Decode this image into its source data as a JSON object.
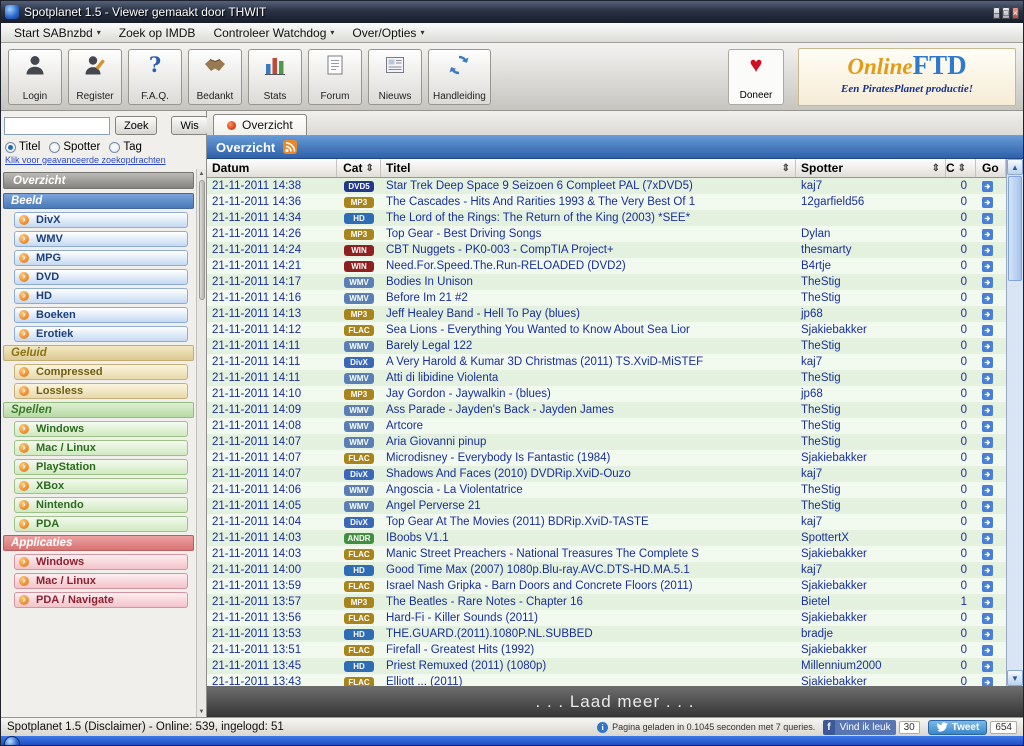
{
  "window": {
    "title": "Spotplanet 1.5 - Viewer gemaakt door THWIT",
    "controls": [
      {
        "name": "minimize",
        "glyph": "–"
      },
      {
        "name": "maximize",
        "glyph": "□"
      },
      {
        "name": "close",
        "glyph": "×"
      }
    ]
  },
  "menu": {
    "items": [
      {
        "label": "Start SABnzbd",
        "dropdown": true
      },
      {
        "label": "Zoek op IMDB",
        "dropdown": false
      },
      {
        "label": "Controleer Watchdog",
        "dropdown": true
      },
      {
        "label": "Over/Opties",
        "dropdown": true
      }
    ]
  },
  "toolbar": {
    "buttons": [
      {
        "label": "Login",
        "icon": "user"
      },
      {
        "label": "Register",
        "icon": "user-edit"
      },
      {
        "label": "F.A.Q.",
        "icon": "question"
      },
      {
        "label": "Bedankt",
        "icon": "handshake"
      },
      {
        "label": "Stats",
        "icon": "chart"
      },
      {
        "label": "Forum",
        "icon": "document"
      },
      {
        "label": "Nieuws",
        "icon": "news"
      },
      {
        "label": "Handleiding",
        "icon": "refresh"
      }
    ],
    "doneer": {
      "label": "Doneer",
      "icon": "heart"
    },
    "logo": {
      "title_online": "Online",
      "title_ftd": "FTD",
      "subtitle": "Een PiratesPlanet productie!"
    }
  },
  "search": {
    "value": "",
    "zoek": "Zoek",
    "wis": "Wis",
    "radios": [
      {
        "label": "Titel",
        "checked": true
      },
      {
        "label": "Spotter",
        "checked": false
      },
      {
        "label": "Tag",
        "checked": false
      }
    ],
    "advanced_link": "Klik voor geavanceerde zoekopdrachten"
  },
  "sidebar": {
    "overzicht": "Overzicht",
    "sections": [
      {
        "title": "Beeld",
        "theme": "blue",
        "items": [
          "DivX",
          "WMV",
          "MPG",
          "DVD",
          "HD",
          "Boeken",
          "Erotiek"
        ]
      },
      {
        "title": "Geluid",
        "theme": "tan",
        "items": [
          "Compressed",
          "Lossless"
        ]
      },
      {
        "title": "Spellen",
        "theme": "green",
        "items": [
          "Windows",
          "Mac / Linux",
          "PlayStation",
          "XBox",
          "Nintendo",
          "PDA"
        ]
      },
      {
        "title": "Applicaties",
        "theme": "red",
        "items": [
          "Windows",
          "Mac / Linux",
          "PDA / Navigate"
        ]
      }
    ]
  },
  "main": {
    "tab": "Overzicht",
    "header": "Overzicht",
    "load_more": ". . . Laad meer . . ."
  },
  "table": {
    "columns": [
      {
        "label": "Datum",
        "key": "datum",
        "sort": false
      },
      {
        "label": "Cat",
        "key": "cat",
        "sort": true
      },
      {
        "label": "Titel",
        "key": "titel",
        "sort": true
      },
      {
        "label": "Spotter",
        "key": "spotter",
        "sort": true
      },
      {
        "label": "C",
        "key": "c",
        "sort": true
      },
      {
        "label": "Go",
        "key": "go",
        "sort": false
      }
    ],
    "cat_colors": {
      "DVD5": "#23388c",
      "MP3": "#a8841c",
      "HD": "#2e6cb5",
      "WIN": "#8f2020",
      "WMV": "#5a7fb5",
      "FLAC": "#a8841c",
      "DivX": "#3a68b8",
      "ANDR": "#3f8f3f"
    },
    "rows": [
      {
        "datum": "21-11-2011 14:38",
        "cat": "DVD5",
        "titel": "Star Trek Deep Space 9 Seizoen 6 Compleet PAL (7xDVD5)",
        "spotter": "kaj7",
        "c": "0"
      },
      {
        "datum": "21-11-2011 14:36",
        "cat": "MP3",
        "titel": "The Cascades - Hits And Rarities 1993 & The Very Best Of 1",
        "spotter": "12garfield56",
        "c": "0"
      },
      {
        "datum": "21-11-2011 14:34",
        "cat": "HD",
        "titel": "The Lord of the Rings: The Return of the King (2003) *SEE*",
        "spotter": "",
        "c": "0"
      },
      {
        "datum": "21-11-2011 14:26",
        "cat": "MP3",
        "titel": "Top Gear - Best Driving Songs",
        "spotter": "Dylan",
        "c": "0"
      },
      {
        "datum": "21-11-2011 14:24",
        "cat": "WIN",
        "titel": "CBT Nuggets - PK0-003 - CompTIA Project+",
        "spotter": "thesmarty",
        "c": "0"
      },
      {
        "datum": "21-11-2011 14:21",
        "cat": "WIN",
        "titel": "Need.For.Speed.The.Run-RELOADED (DVD2)",
        "spotter": "B4rtje",
        "c": "0"
      },
      {
        "datum": "21-11-2011 14:17",
        "cat": "WMV",
        "titel": "Bodies In Unison",
        "spotter": "TheStig",
        "c": "0"
      },
      {
        "datum": "21-11-2011 14:16",
        "cat": "WMV",
        "titel": "Before Im 21 #2",
        "spotter": "TheStig",
        "c": "0"
      },
      {
        "datum": "21-11-2011 14:13",
        "cat": "MP3",
        "titel": "Jeff Healey Band - Hell To Pay (blues)",
        "spotter": "jp68",
        "c": "0"
      },
      {
        "datum": "21-11-2011 14:12",
        "cat": "FLAC",
        "titel": "Sea Lions - Everything You Wanted to Know About Sea Lior",
        "spotter": "Sjakiebakker",
        "c": "0"
      },
      {
        "datum": "21-11-2011 14:11",
        "cat": "WMV",
        "titel": "Barely Legal 122",
        "spotter": "TheStig",
        "c": "0"
      },
      {
        "datum": "21-11-2011 14:11",
        "cat": "DivX",
        "titel": "A Very Harold & Kumar 3D Christmas (2011) TS.XviD-MiSTEF",
        "spotter": "kaj7",
        "c": "0"
      },
      {
        "datum": "21-11-2011 14:11",
        "cat": "WMV",
        "titel": "Atti di libidine Violenta",
        "spotter": "TheStig",
        "c": "0"
      },
      {
        "datum": "21-11-2011 14:10",
        "cat": "MP3",
        "titel": "Jay Gordon - Jaywalkin - (blues)",
        "spotter": "jp68",
        "c": "0"
      },
      {
        "datum": "21-11-2011 14:09",
        "cat": "WMV",
        "titel": "Ass Parade - Jayden's Back - Jayden James",
        "spotter": "TheStig",
        "c": "0"
      },
      {
        "datum": "21-11-2011 14:08",
        "cat": "WMV",
        "titel": "Artcore",
        "spotter": "TheStig",
        "c": "0"
      },
      {
        "datum": "21-11-2011 14:07",
        "cat": "WMV",
        "titel": "Aria Giovanni pinup",
        "spotter": "TheStig",
        "c": "0"
      },
      {
        "datum": "21-11-2011 14:07",
        "cat": "FLAC",
        "titel": "Microdisney - Everybody Is Fantastic (1984)",
        "spotter": "Sjakiebakker",
        "c": "0"
      },
      {
        "datum": "21-11-2011 14:07",
        "cat": "DivX",
        "titel": "Shadows And Faces (2010) DVDRip.XviD-Ouzo",
        "spotter": "kaj7",
        "c": "0"
      },
      {
        "datum": "21-11-2011 14:06",
        "cat": "WMV",
        "titel": "Angoscia - La Violentatrice",
        "spotter": "TheStig",
        "c": "0"
      },
      {
        "datum": "21-11-2011 14:05",
        "cat": "WMV",
        "titel": "Angel Perverse 21",
        "spotter": "TheStig",
        "c": "0"
      },
      {
        "datum": "21-11-2011 14:04",
        "cat": "DivX",
        "titel": "Top Gear At The Movies (2011) BDRip.XviD-TASTE",
        "spotter": "kaj7",
        "c": "0"
      },
      {
        "datum": "21-11-2011 14:03",
        "cat": "ANDR",
        "titel": "IBoobs V1.1",
        "spotter": "SpottertX",
        "c": "0"
      },
      {
        "datum": "21-11-2011 14:03",
        "cat": "FLAC",
        "titel": "Manic Street Preachers - National Treasures The Complete S",
        "spotter": "Sjakiebakker",
        "c": "0"
      },
      {
        "datum": "21-11-2011 14:00",
        "cat": "HD",
        "titel": "Good Time Max (2007) 1080p.Blu-ray.AVC.DTS-HD.MA.5.1",
        "spotter": "kaj7",
        "c": "0"
      },
      {
        "datum": "21-11-2011 13:59",
        "cat": "FLAC",
        "titel": "Israel Nash Gripka - Barn Doors and Concrete Floors (2011)",
        "spotter": "Sjakiebakker",
        "c": "0"
      },
      {
        "datum": "21-11-2011 13:57",
        "cat": "MP3",
        "titel": "The Beatles - Rare Notes - Chapter 16",
        "spotter": "Bietel",
        "c": "1"
      },
      {
        "datum": "21-11-2011 13:56",
        "cat": "FLAC",
        "titel": "Hard-Fi - Killer Sounds (2011)",
        "spotter": "Sjakiebakker",
        "c": "0"
      },
      {
        "datum": "21-11-2011 13:53",
        "cat": "HD",
        "titel": "THE.GUARD.(2011).1080P.NL.SUBBED",
        "spotter": "bradje",
        "c": "0"
      },
      {
        "datum": "21-11-2011 13:51",
        "cat": "FLAC",
        "titel": "Firefall - Greatest Hits (1992)",
        "spotter": "Sjakiebakker",
        "c": "0"
      },
      {
        "datum": "21-11-2011 13:45",
        "cat": "HD",
        "titel": "Priest Remuxed (2011) (1080p)",
        "spotter": "Millennium2000",
        "c": "0"
      },
      {
        "datum": "21-11-2011 13:43",
        "cat": "FLAC",
        "titel": "Elliott ... (2011)",
        "spotter": "Sjakiebakker",
        "c": "0"
      }
    ]
  },
  "statusbar": {
    "left": "Spotplanet 1.5 (Disclaimer) - Online: 539, ingelogd: 51",
    "page_info": "Pagina geladen in 0.1045 seconden met 7 queries.",
    "fb_label": "Vind ik leuk",
    "fb_count": "30",
    "tweet_label": "Tweet",
    "tweet_count": "654"
  }
}
